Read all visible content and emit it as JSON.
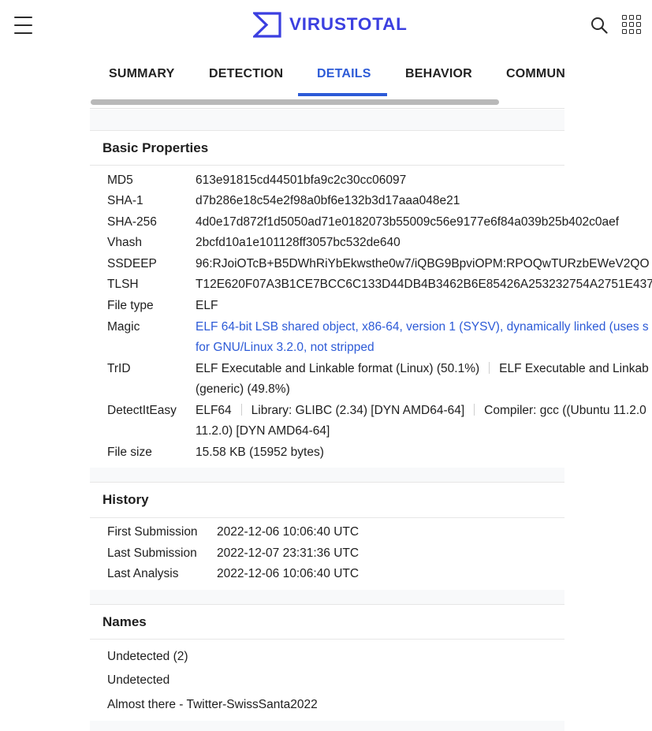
{
  "header": {
    "logo_text": "VIRUSTOTAL",
    "brand_color": "#3b3fe0",
    "icons": [
      "hamburger-menu-icon",
      "virustotal-logo-icon",
      "search-icon",
      "apps-grid-icon"
    ]
  },
  "tabs": [
    {
      "label": "SUMMARY",
      "active": false
    },
    {
      "label": "DETECTION",
      "active": false
    },
    {
      "label": "DETAILS",
      "active": true
    },
    {
      "label": "BEHAVIOR",
      "active": false
    },
    {
      "label": "COMMUNI",
      "active": false
    }
  ],
  "accent_color": "#2d5bd7",
  "basic_properties": {
    "title": "Basic Properties",
    "rows": [
      {
        "label": "MD5",
        "value": "613e91815cd44501bfa9c2c30cc06097"
      },
      {
        "label": "SHA-1",
        "value": "d7b286e18c54e2f98a0bf6e132b3d17aaa048e21"
      },
      {
        "label": "SHA-256",
        "value": "4d0e17d872f1d5050ad71e0182073b55009c56e9177e6f84a039b25b402c0aef"
      },
      {
        "label": "Vhash",
        "value": "2bcfd10a1e101128ff3057bc532de640"
      },
      {
        "label": "SSDEEP",
        "value": "96:RJoiOTcB+B5DWhRiYbEkwsthe0w7/iQBG9BpviOPM:RPOQwTURzbEWeV2QO"
      },
      {
        "label": "TLSH",
        "value": "T12E620F07A3B1CE7BCC6C133D44DB4B3462B6E85426A253232754A2751E437"
      },
      {
        "label": "File type",
        "value": "ELF"
      },
      {
        "label": "Magic",
        "value_line1": "ELF 64-bit LSB shared object, x86-64, version 1 (SYSV), dynamically linked (uses s",
        "value_line2": "for GNU/Linux 3.2.0, not stripped"
      },
      {
        "label": "TrID",
        "part1": "ELF Executable and Linkable format (Linux) (50.1%)",
        "part2": "ELF Executable and Linkab",
        "line2": "(generic) (49.8%)"
      },
      {
        "label": "DetectItEasy",
        "part1": "ELF64",
        "part2": "Library: GLIBC (2.34) [DYN AMD64-64]",
        "part3": "Compiler: gcc ((Ubuntu 11.2.0",
        "line2": "11.2.0) [DYN AMD64-64]"
      },
      {
        "label": "File size",
        "value": "15.58 KB (15952 bytes)"
      }
    ]
  },
  "history": {
    "title": "History",
    "rows": [
      {
        "label": "First Submission",
        "value": "2022-12-06 10:06:40 UTC"
      },
      {
        "label": "Last Submission",
        "value": "2022-12-07 23:31:36 UTC"
      },
      {
        "label": "Last Analysis",
        "value": "2022-12-06 10:06:40 UTC"
      }
    ]
  },
  "names": {
    "title": "Names",
    "items": [
      "Undetected (2)",
      "Undetected",
      "Almost there - Twitter-SwissSanta2022"
    ]
  }
}
